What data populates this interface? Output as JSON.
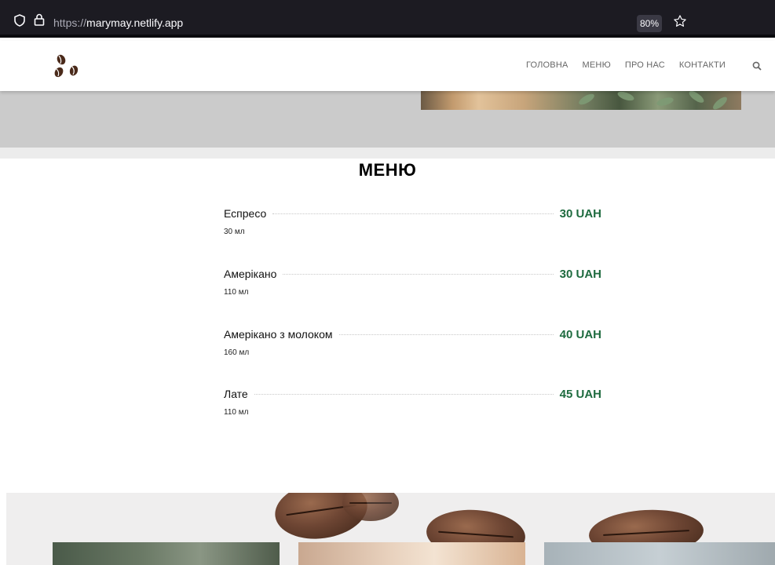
{
  "browser": {
    "url_protocol": "https://",
    "url_host": "marymay.netlify.app",
    "zoom": "80%"
  },
  "nav": {
    "items": [
      "ГОЛОВНА",
      "МЕНЮ",
      "ПРО НАС",
      "КОНТАКТИ"
    ]
  },
  "menu": {
    "title": "МЕНЮ",
    "items": [
      {
        "name": "Еспресо",
        "price": "30 UAH",
        "volume": "30 мл"
      },
      {
        "name": "Амерікано",
        "price": "30 UAH",
        "volume": "110 мл"
      },
      {
        "name": "Амерікано з молоком",
        "price": "40 UAH",
        "volume": "160 мл"
      },
      {
        "name": "Лате",
        "price": "45 UAH",
        "volume": "110 мл"
      }
    ]
  },
  "colors": {
    "browser_bg": "#1c1b22",
    "price_green": "#1e6b3f",
    "hero_gray": "#cbcbcb",
    "logo_brown": "#4a2a1a"
  }
}
